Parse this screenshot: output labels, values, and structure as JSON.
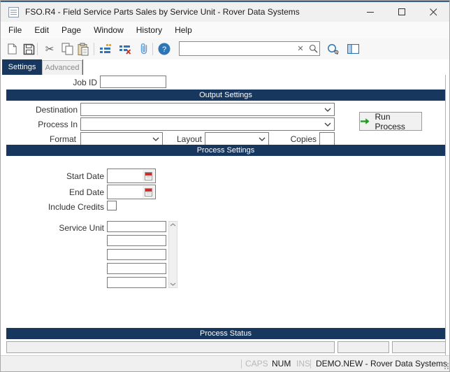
{
  "window": {
    "title": "FSO.R4 - Field Service Parts Sales by Service Unit - Rover Data Systems"
  },
  "menu": {
    "items": [
      "File",
      "Edit",
      "Page",
      "Window",
      "History",
      "Help"
    ]
  },
  "toolbar": {
    "search_value": "",
    "icons": [
      "new-document",
      "save",
      "cut",
      "copy",
      "paste",
      "add-record",
      "delete-record",
      "attachment",
      "help",
      "clear-search",
      "search",
      "search-view",
      "layout-panels"
    ]
  },
  "glyphs": {
    "cut": "✂",
    "clear_search": "✕",
    "question_mark": "?"
  },
  "tabs": {
    "settings": "Settings",
    "advanced": "Advanced"
  },
  "form": {
    "job_id_label": "Job ID",
    "job_id_value": "",
    "output": {
      "header": "Output Settings",
      "destination_label": "Destination",
      "destination_value": "",
      "process_in_label": "Process In",
      "process_in_value": "",
      "format_label": "Format",
      "format_value": "",
      "layout_label": "Layout",
      "layout_value": "",
      "copies_label": "Copies",
      "copies_value": "",
      "run_button_label": "Run Process"
    },
    "process": {
      "header": "Process Settings",
      "start_date_label": "Start Date",
      "start_date_value": "",
      "end_date_label": "End Date",
      "end_date_value": "",
      "include_credits_label": "Include Credits",
      "include_credits_checked": false,
      "service_unit_label": "Service Unit",
      "service_unit_values": [
        "",
        "",
        "",
        "",
        ""
      ]
    },
    "status_section": {
      "header": "Process Status",
      "fields": [
        "",
        "",
        ""
      ]
    }
  },
  "status_bar": {
    "caps": "CAPS",
    "num": "NUM",
    "ins": "INS",
    "context": "DEMO.NEW - Rover Data Systems"
  },
  "colors": {
    "accent_navy": "#17375e",
    "titlebar_accent": "#38618c",
    "icon_blue": "#2e75b6",
    "run_arrow_green": "#1f9d1f",
    "calendar_red": "#c9302c",
    "record_orange": "#e8a33d",
    "delete_red": "#c0392b"
  }
}
